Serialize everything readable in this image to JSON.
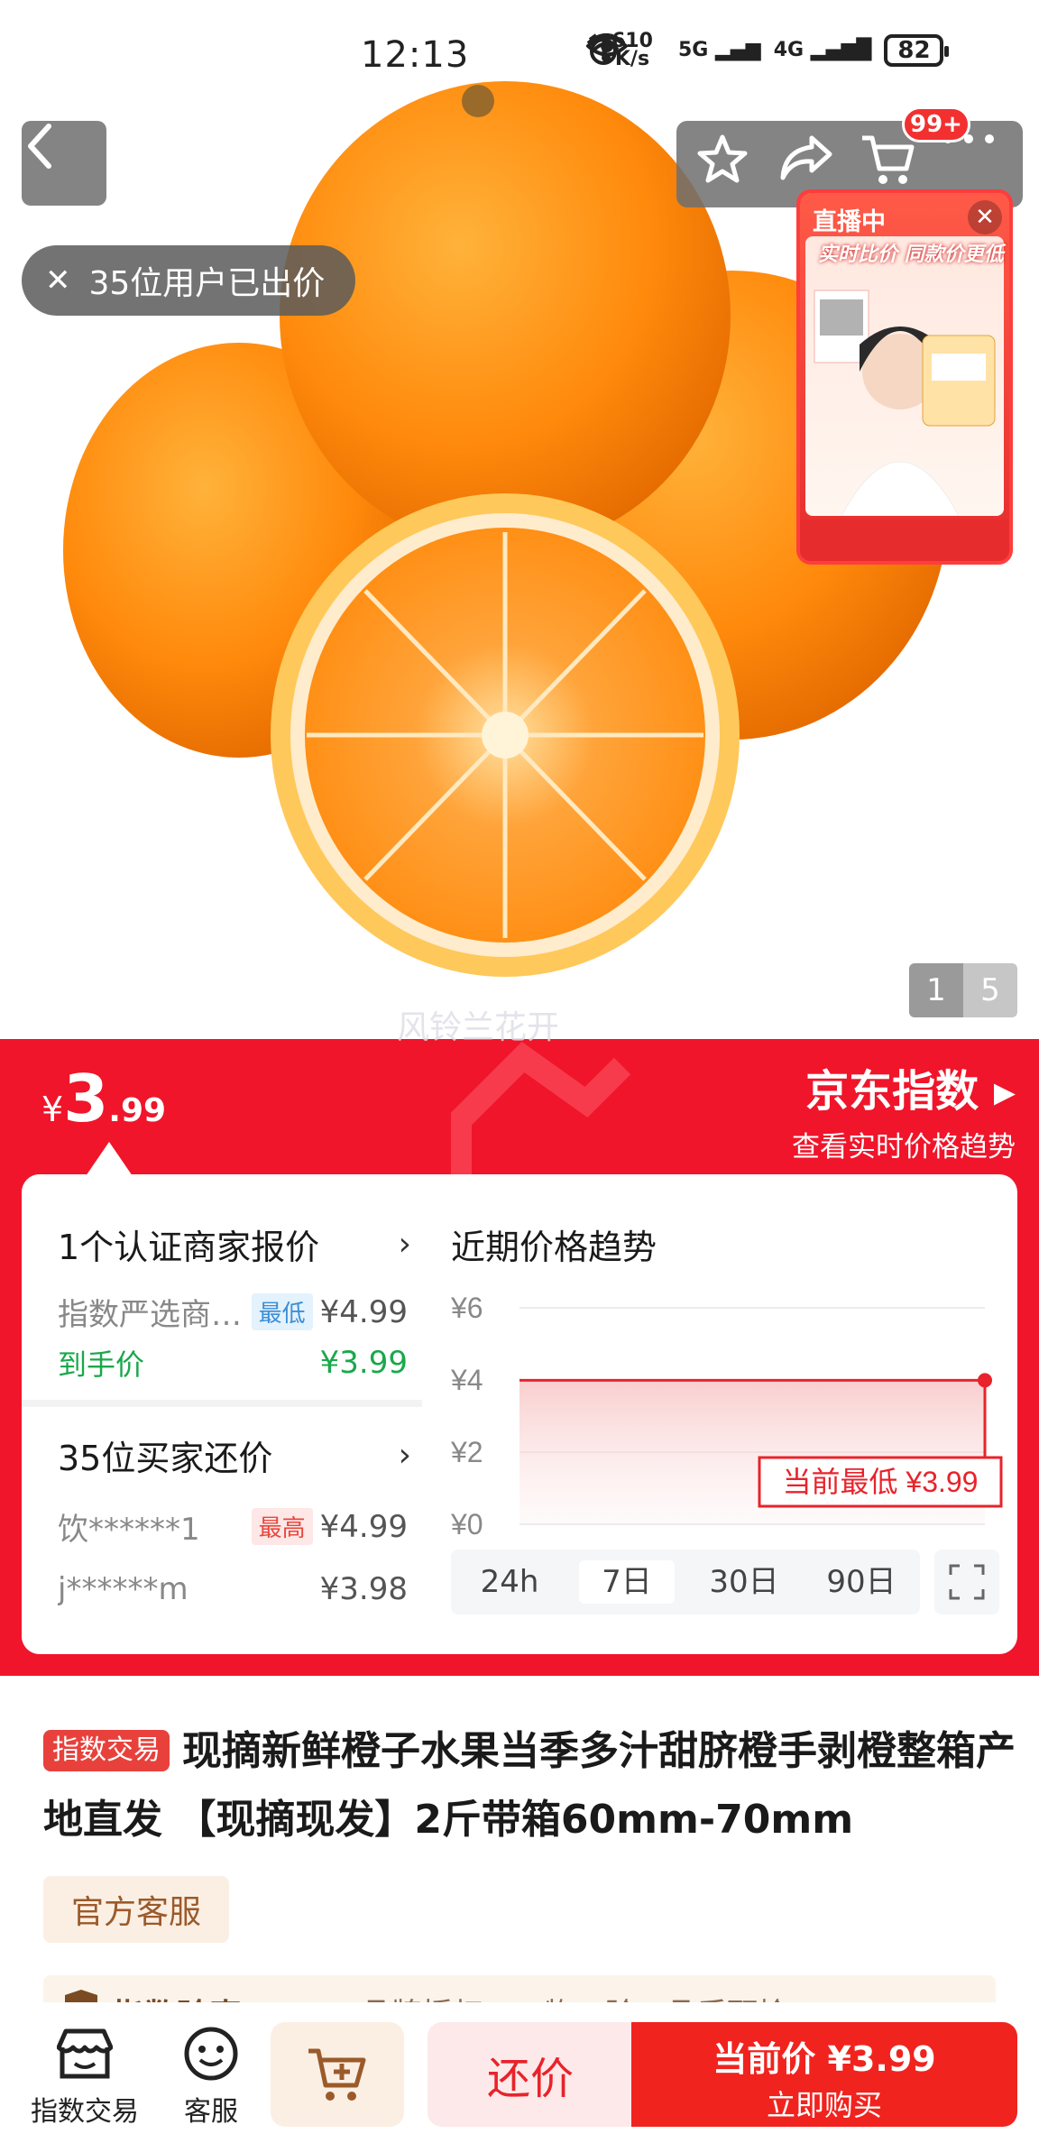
{
  "status_bar": {
    "time": "12:13",
    "net_speed_top": "610",
    "net_speed_unit": "K/s",
    "sim1": "5G",
    "sim2": "4G",
    "battery": "82"
  },
  "hero": {
    "bid_chip": "35位用户已出价",
    "cart_badge": "99+",
    "page_current": "1",
    "page_total": "5",
    "watermark": "风铃兰花开",
    "live": {
      "tag": "直播中",
      "headline": "实时比价 同款价更低"
    }
  },
  "price_banner": {
    "currency": "¥",
    "price_int": "3",
    "price_dec": ".99",
    "jd_index_title": "京东指数",
    "jd_index_sub": "查看实时价格趋势"
  },
  "merchant_quotes": {
    "header": "1个认证商家报价",
    "rows": [
      {
        "name": "指数严选商…",
        "tag": "最低",
        "price": "¥4.99"
      }
    ],
    "final_label": "到手价",
    "final_price": "¥3.99"
  },
  "buyer_bids": {
    "header": "35位买家还价",
    "rows": [
      {
        "name": "饮******1",
        "tag": "最高",
        "price": "¥4.99"
      },
      {
        "name": "j******m",
        "tag": "",
        "price": "¥3.98"
      }
    ]
  },
  "trend": {
    "title": "近期价格趋势",
    "current_label": "当前最低 ¥3.99",
    "ranges": [
      "24h",
      "7日",
      "30日",
      "90日"
    ],
    "selected_range": "7日"
  },
  "chart_data": {
    "type": "line",
    "title": "近期价格趋势",
    "ytick_labels": [
      "¥6",
      "¥4",
      "¥2",
      "¥0"
    ],
    "ylim": [
      0,
      6
    ],
    "series": [
      {
        "x": [
          0,
          1,
          2,
          3,
          4,
          5,
          6
        ],
        "y": [
          3.99,
          3.99,
          3.99,
          3.99,
          3.99,
          3.99,
          3.99
        ]
      }
    ],
    "grid": true,
    "color": "#e8232b"
  },
  "product": {
    "index_tag": "指数交易",
    "title": "现摘新鲜橙子水果当季多汁甜脐橙手剥橙整箱产地直发 【现摘现发】2斤带箱60mm-70mm",
    "service_button": "官方客服",
    "guarantee_title": "指数验真",
    "guarantee_rest": "品牌授权 / 一物一验 / 品质甄检"
  },
  "bottom_bar": {
    "store_label": "指数交易",
    "service_label": "客服",
    "counter_label": "还价",
    "buy_line1": "当前价 ¥3.99",
    "buy_line2": "立即购买"
  }
}
